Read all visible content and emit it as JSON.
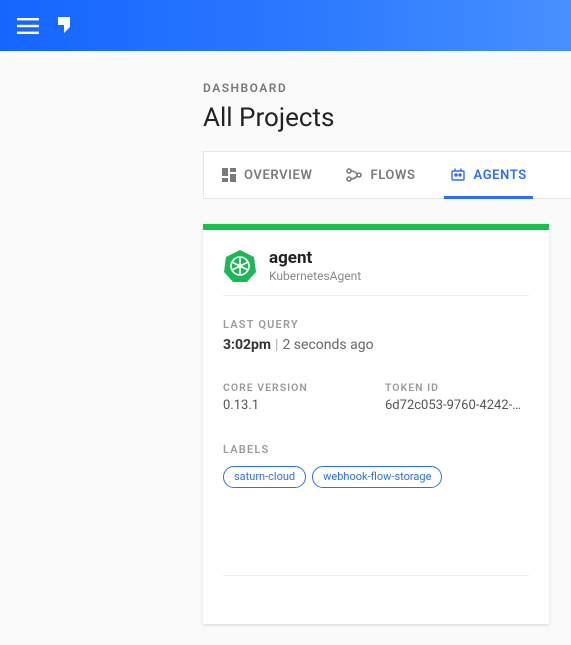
{
  "header": {
    "breadcrumb": "DASHBOARD",
    "title": "All Projects"
  },
  "tabs": {
    "overview": "OVERVIEW",
    "flows": "FLOWS",
    "agents": "AGENTS"
  },
  "agent": {
    "name": "agent",
    "type": "KubernetesAgent",
    "last_query_label": "LAST QUERY",
    "last_query_time": "3:02pm",
    "last_query_relative": "2 seconds ago",
    "core_version_label": "CORE VERSION",
    "core_version": "0.13.1",
    "token_id_label": "TOKEN ID",
    "token_id": "6d72c053-9760-4242-…",
    "labels_label": "LABELS",
    "labels": [
      "saturn-cloud",
      "webhook-flow-storage"
    ]
  },
  "colors": {
    "accent": "#2f6df6",
    "success": "#18c24a"
  }
}
